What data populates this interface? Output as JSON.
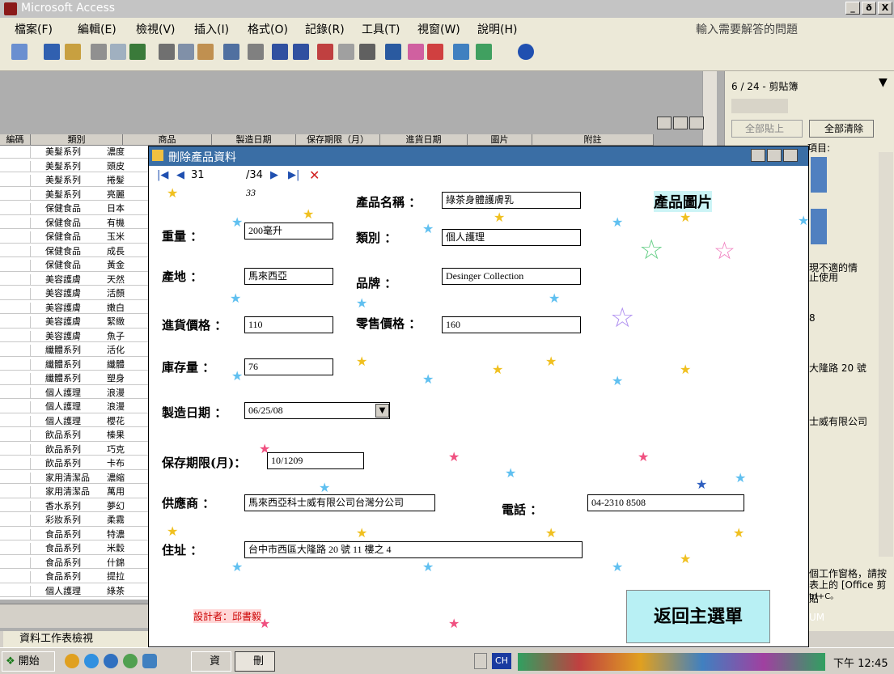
{
  "window": {
    "title": "Microsoft Access",
    "buttons": [
      "_",
      "ð",
      "X"
    ]
  },
  "menu": [
    "檔案(F)",
    "編輯(E)",
    "檢視(V)",
    "插入(I)",
    "格式(O)",
    "記錄(R)",
    "工具(T)",
    "視窗(W)",
    "說明(H)"
  ],
  "help_box": "輸入需要解答的問題",
  "sheet": {
    "headers": [
      "編碼",
      "類別",
      "商品",
      "製造日期",
      "保存期限（月）",
      "進貨日期",
      "圖片",
      "附註"
    ],
    "rows": [
      {
        "cat": "美髮系列",
        "prod": "濃度"
      },
      {
        "cat": "美髮系列",
        "prod": "頭皮"
      },
      {
        "cat": "美髮系列",
        "prod": "捲髮"
      },
      {
        "cat": "美髮系列",
        "prod": "亮麗"
      },
      {
        "cat": "保健食品",
        "prod": "日本"
      },
      {
        "cat": "保健食品",
        "prod": "有機"
      },
      {
        "cat": "保健食品",
        "prod": "玉米"
      },
      {
        "cat": "保健食品",
        "prod": "成長"
      },
      {
        "cat": "保健食品",
        "prod": "黃金"
      },
      {
        "cat": "美容護膚",
        "prod": "天然"
      },
      {
        "cat": "美容護膚",
        "prod": "活顏"
      },
      {
        "cat": "美容護膚",
        "prod": "嫩白"
      },
      {
        "cat": "美容護膚",
        "prod": "緊緻"
      },
      {
        "cat": "美容護膚",
        "prod": "魚子"
      },
      {
        "cat": "纖體系列",
        "prod": "活化"
      },
      {
        "cat": "纖體系列",
        "prod": "纖體"
      },
      {
        "cat": "纖體系列",
        "prod": "塑身"
      },
      {
        "cat": "個人護理",
        "prod": "浪漫"
      },
      {
        "cat": "個人護理",
        "prod": "浪漫"
      },
      {
        "cat": "個人護理",
        "prod": "櫻花"
      },
      {
        "cat": "飲品系列",
        "prod": "榛果"
      },
      {
        "cat": "飲品系列",
        "prod": "巧克"
      },
      {
        "cat": "飲品系列",
        "prod": "卡布"
      },
      {
        "cat": "家用清潔品",
        "prod": "濃縮"
      },
      {
        "cat": "家用清潔品",
        "prod": "萬用"
      },
      {
        "cat": "香水系列",
        "prod": "夢幻"
      },
      {
        "cat": "彩妝系列",
        "prod": "柔霧"
      },
      {
        "cat": "食品系列",
        "prod": "特濃"
      },
      {
        "cat": "食品系列",
        "prod": "米穀"
      },
      {
        "cat": "食品系列",
        "prod": "什錦"
      },
      {
        "cat": "食品系列",
        "prod": "提拉"
      },
      {
        "cat": "個人護理",
        "prod": "綠茶"
      }
    ],
    "status": "資料工作表檢視"
  },
  "taskpane": {
    "title": "6 / 24 - 剪貼簿",
    "paste_all": "全部貼上",
    "clear_all": "全部清除",
    "frag1": "項目:",
    "frag2": "現不適的情",
    "frag3": "止使用",
    "frag4": "8",
    "frag5": "大隆路 20 號",
    "frag6": "士威有限公司",
    "frag7": "個工作窗格，請按",
    "frag8": "表上的 [Office 剪貼",
    "frag9": "trl+C。",
    "frag10": "UM"
  },
  "dialog": {
    "title": "刪除產品資料",
    "record_current": "31",
    "record_total": "/34",
    "record_id": "33",
    "labels": {
      "name": "產品名稱 ：",
      "image": "產品圖片",
      "weight": "重量 ：",
      "category": "類別 ：",
      "origin": "產地 ：",
      "brand": "品牌 ：",
      "cost": "進貨價格 ：",
      "retail": "零售價格 ：",
      "stock": "庫存量 ：",
      "mfg_date": "製造日期 ：",
      "shelf": "保存期限(月)：",
      "supplier": "供應商 ：",
      "phone": "電話 ：",
      "address": "住址 ："
    },
    "values": {
      "name": "綠茶身體護膚乳",
      "weight": "200毫升",
      "category": "個人護理",
      "origin": "馬來西亞",
      "brand": "Desinger Collection",
      "cost": "110",
      "retail": "160",
      "stock": "76",
      "mfg_date": "06/25/08",
      "shelf": "10/1209",
      "supplier": "馬來西亞科士威有限公司台灣分公司",
      "phone": "04-2310 8508",
      "address": "台中市西區大隆路 20 號 11 樓之 4"
    },
    "return_button": "返回主選單",
    "designer": "設計者：邱書毅"
  },
  "taskbar": {
    "start": "開始",
    "items": [
      "資",
      "刪"
    ],
    "lang": "CH",
    "clock": "下午 12:45"
  }
}
